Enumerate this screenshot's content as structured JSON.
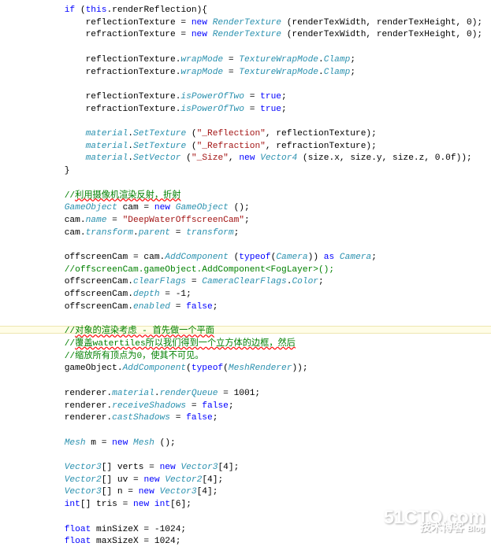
{
  "code": [
    "        if (this.renderReflection){",
    "            reflectionTexture = new RenderTexture (renderTexWidth, renderTexHeight, 0);",
    "            refractionTexture = new RenderTexture (renderTexWidth, renderTexHeight, 0);",
    "",
    "            reflectionTexture.wrapMode = TextureWrapMode.Clamp;",
    "            refractionTexture.wrapMode = TextureWrapMode.Clamp;",
    "",
    "            reflectionTexture.isPowerOfTwo = true;",
    "            refractionTexture.isPowerOfTwo = true;",
    "",
    "            material.SetTexture (\"_Reflection\", reflectionTexture);",
    "            material.SetTexture (\"_Refraction\", refractionTexture);",
    "            material.SetVector (\"_Size\", new Vector4 (size.x, size.y, size.z, 0.0f));",
    "        }",
    "",
    "        //利用摄像机渲染反射，折射",
    "        GameObject cam = new GameObject ();",
    "        cam.name = \"DeepWaterOffscreenCam\";",
    "        cam.transform.parent = transform;",
    "",
    "        offscreenCam = cam.AddComponent (typeof(Camera)) as Camera;",
    "        //offscreenCam.gameObject.AddComponent<FogLayer>();",
    "        offscreenCam.clearFlags = CameraClearFlags.Color;",
    "        offscreenCam.depth = -1;",
    "        offscreenCam.enabled = false;",
    "",
    "        //对象的渲染考虑 - 首先做一个平面",
    "        //覆盖watertiles所以我们得到一个立方体的边框，然后",
    "        //缩放所有顶点为0，使其不可见。",
    "        gameObject.AddComponent(typeof(MeshRenderer));",
    "",
    "        renderer.material.renderQueue = 1001;",
    "        renderer.receiveShadows = false;",
    "        renderer.castShadows = false;",
    "",
    "        Mesh m = new Mesh ();",
    "",
    "        Vector3[] verts = new Vector3[4];",
    "        Vector2[] uv = new Vector2[4];",
    "        Vector3[] n = new Vector3[4];",
    "        int[] tris = new int[6];",
    "",
    "        float minSizeX = -1024;",
    "        float maxSizeX = 1024;"
  ],
  "tokens": {
    "keywords": [
      "if",
      "this",
      "new",
      "true",
      "typeof",
      "as",
      "int",
      "float",
      "false"
    ],
    "types": [
      "RenderTexture",
      "TextureWrapMode",
      "SetTexture",
      "SetVector",
      "Vector4",
      "GameObject",
      "AddComponent",
      "Camera",
      "CameraClearFlags",
      "MeshRenderer",
      "Mesh",
      "Vector3",
      "Vector2"
    ],
    "italic_props": [
      "wrapMode",
      "Clamp",
      "isPowerOfTwo",
      "name",
      "transform",
      "parent",
      "clearFlags",
      "Color",
      "depth",
      "enabled",
      "material",
      "renderQueue",
      "receiveShadows",
      "castShadows"
    ],
    "strings": [
      "\"_Reflection\"",
      "\"_Refraction\"",
      "\"_Size\"",
      "\"DeepWaterOffscreenCam\""
    ],
    "comments_idx": [
      15,
      21,
      26,
      27,
      28
    ],
    "comment_err_idx": [
      15,
      26,
      27
    ]
  },
  "yellow_band_between": [
    25,
    26
  ],
  "watermark": {
    "main": "51CTO.com",
    "sub": "技术博客",
    "blog": "Blog"
  }
}
